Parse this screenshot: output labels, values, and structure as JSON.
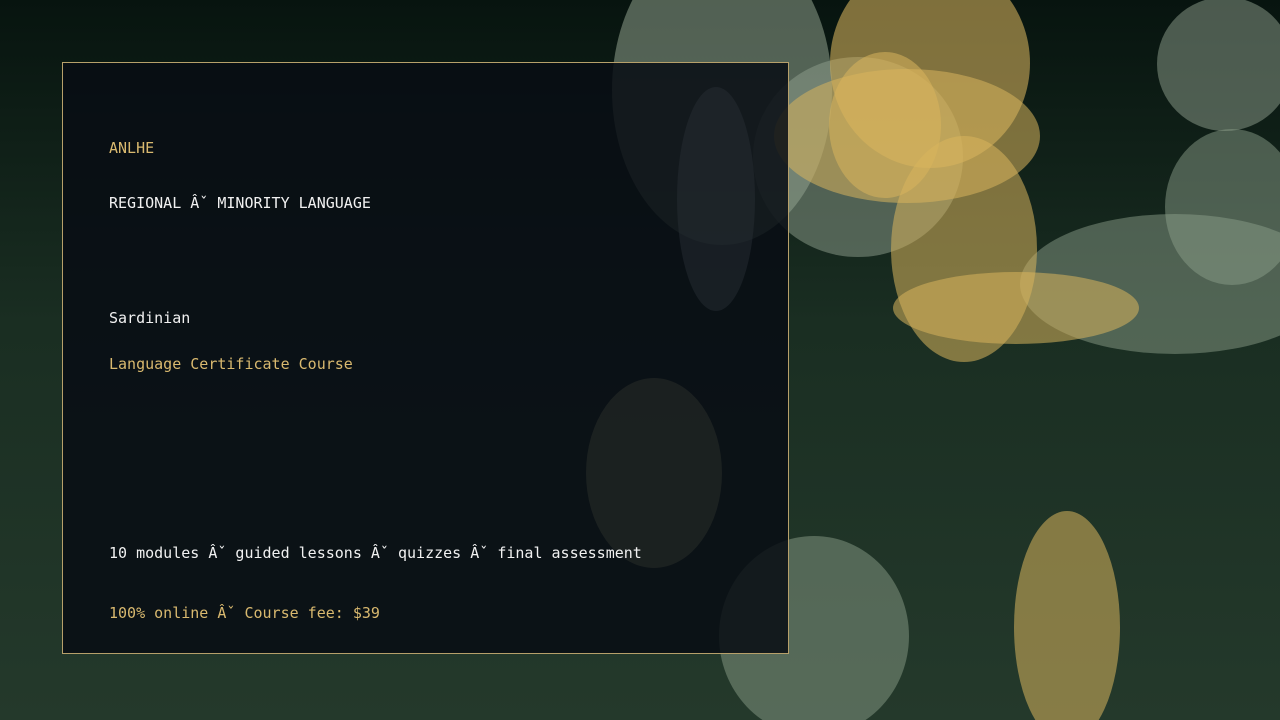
{
  "brand": "ANLHE",
  "category": "REGIONAL Âˇ MINORITY LANGUAGE",
  "language": "Sardinian",
  "course_type": "Language Certificate Course",
  "features": "10 modules Âˇ guided lessons Âˇ quizzes Âˇ final assessment",
  "pricing": "100% online Âˇ Course fee: $39",
  "colors": {
    "accent_gold": "#d9b96f",
    "card_background": "#080d14",
    "card_border": "#b7a06a",
    "background_dark": "#07140f",
    "background_green": "#24392b",
    "bokeh_gold": "#d8b45d",
    "bokeh_sage": "#8fa08d"
  }
}
